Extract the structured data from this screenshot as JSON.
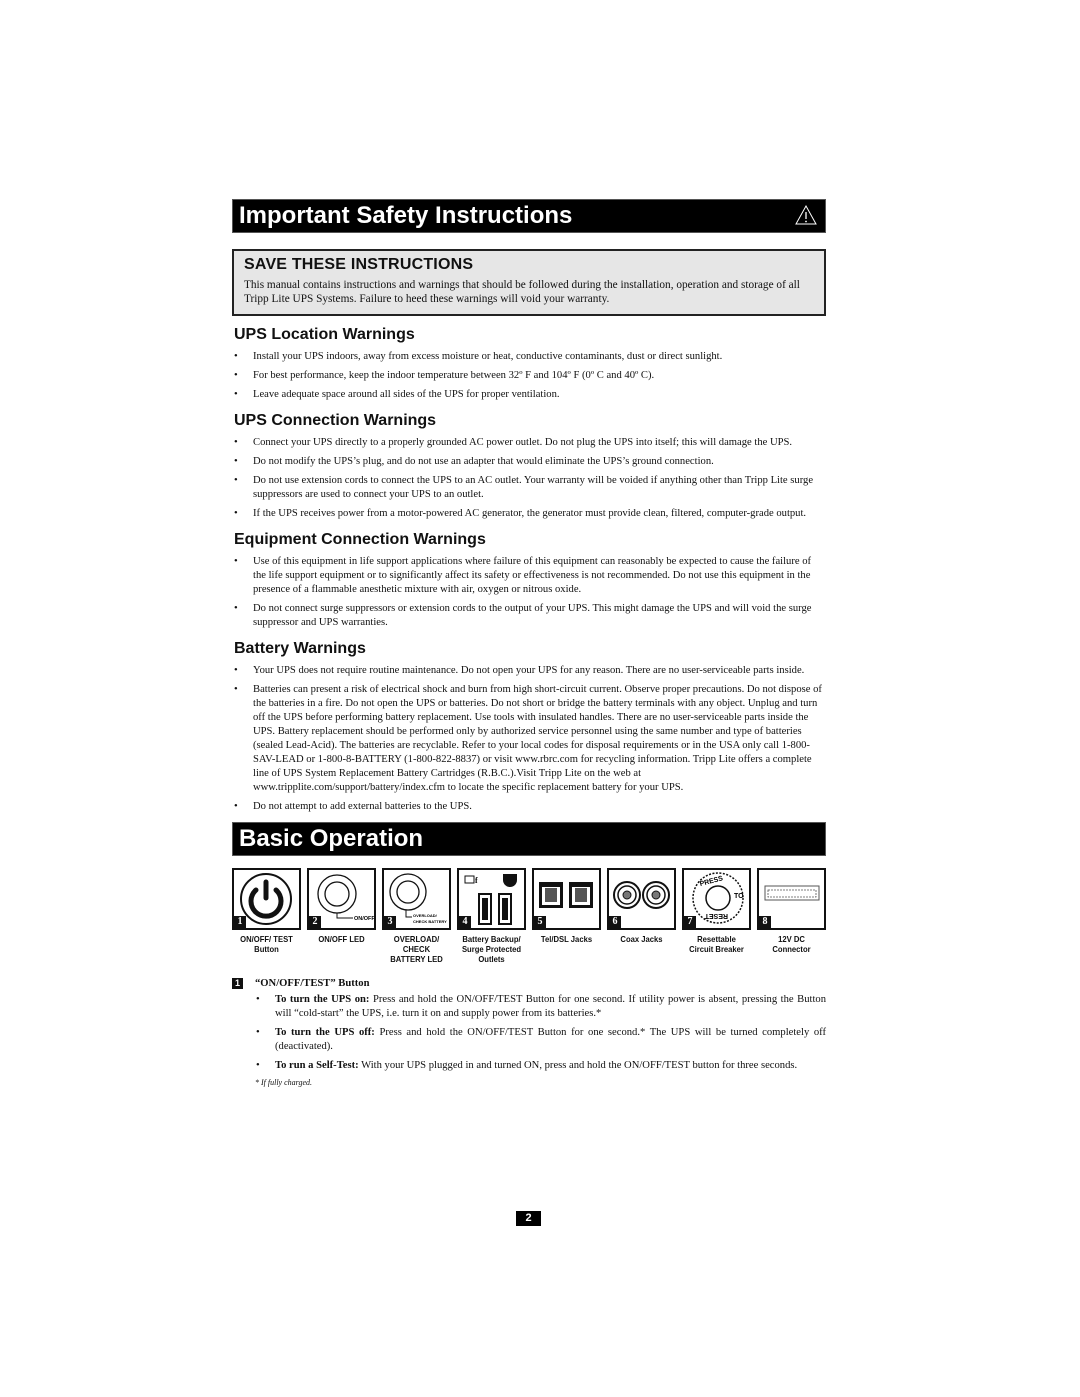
{
  "header": {
    "title": "Important Safety Instructions",
    "icon": "warning-triangle-icon"
  },
  "save_box": {
    "title": "SAVE THESE INSTRUCTIONS",
    "text": "This manual contains instructions and warnings that should be followed during the installation, operation and storage of all Tripp Lite UPS Systems. Failure to heed these warnings will void your warranty."
  },
  "sections": [
    {
      "title": "UPS Location Warnings",
      "items": [
        "Install your UPS indoors, away from excess moisture or heat, conductive contaminants, dust or direct sunlight.",
        "For best performance, keep the indoor temperature between 32º F and 104º F (0º C and 40º C).",
        "Leave adequate space around all sides of the UPS for proper ventilation."
      ]
    },
    {
      "title": "UPS Connection Warnings",
      "items": [
        "Connect your UPS directly to a properly grounded AC power outlet. Do not plug the UPS into itself; this will damage the UPS.",
        "Do not modify the UPS’s plug, and do not use an adapter that would eliminate the UPS’s ground connection.",
        "Do not use extension cords to connect the UPS to an AC outlet. Your warranty will be voided if anything other than Tripp Lite surge suppressors are used to connect your UPS to an outlet.",
        "If the UPS receives power from a motor-powered AC generator, the generator must provide clean, filtered, computer-grade output."
      ]
    },
    {
      "title": "Equipment Connection Warnings",
      "items": [
        "Use of this equipment in life support applications where failure of this equipment can reasonably be expected to cause the failure of the life support equipment or to significantly affect its safety or effectiveness is not recommended. Do not use this equipment in the presence of a flammable anesthetic mixture with air, oxygen or nitrous oxide.",
        "Do not connect surge suppressors or extension cords to the output of your UPS. This might damage the UPS and will void the surge suppressor and UPS warranties."
      ]
    },
    {
      "title": "Battery Warnings",
      "items": [
        "Your UPS does not require routine maintenance. Do not open your UPS for any reason. There are no user-serviceable parts inside.",
        "Batteries can present a risk of electrical shock and burn from high short-circuit current. Observe proper precautions. Do not dispose of the batteries in a fire. Do not open the UPS or batteries. Do not short or bridge the battery terminals with any object. Unplug and turn off the UPS before performing battery replacement. Use tools with insulated handles. There are no user-serviceable parts inside the UPS. Battery replacement should be performed only by authorized service personnel using the same number and type of batteries (sealed Lead-Acid). The batteries are recyclable. Refer to your local codes for disposal requirements or in the USA only call 1-800-SAV-LEAD or 1-800-8-BATTERY (1-800-822-8837) or visit www.rbrc.com for recycling information. Tripp Lite offers a complete line of UPS System Replacement Battery Cartridges (R.B.C.).Visit Tripp Lite on the web at www.tripplite.com/support/battery/index.cfm to locate the specific replacement battery for your UPS.",
        "Do not attempt to add external batteries to the UPS."
      ]
    }
  ],
  "basic_operation": {
    "title": "Basic Operation",
    "panels": [
      {
        "num": "1",
        "icon": "power-button-icon",
        "caption": "ON/OFF/ TEST Button"
      },
      {
        "num": "2",
        "icon": "on-off-led-icon",
        "label": "ON/OFF",
        "caption": "ON/OFF LED"
      },
      {
        "num": "3",
        "icon": "overload-led-icon",
        "label": "OVERLOAD/ CHECK BATTERY",
        "caption": "OVERLOAD/ CHECK BATTERY LED"
      },
      {
        "num": "4",
        "icon": "outlets-icon",
        "caption": "Battery Backup/ Surge Protected Outlets"
      },
      {
        "num": "5",
        "icon": "tel-jack-icon",
        "caption": "Tel/DSL Jacks"
      },
      {
        "num": "6",
        "icon": "coax-jack-icon",
        "caption": "Coax Jacks"
      },
      {
        "num": "7",
        "icon": "circuit-breaker-icon",
        "label": "PRESS TO RESET",
        "caption": "Resettable Circuit Breaker"
      },
      {
        "num": "8",
        "icon": "dc-connector-icon",
        "caption": "12V DC Connector"
      }
    ],
    "button_section": {
      "num": "1",
      "title": "“ON/OFF/TEST” Button",
      "items": [
        {
          "lead": "To turn the UPS on:",
          "text": " Press and hold the ON/OFF/TEST Button for one second. If utility power is absent, pressing the Button will “cold-start” the UPS, i.e. turn it on and supply power from its batteries.*"
        },
        {
          "lead": "To turn the UPS off:",
          "text": " Press and hold the ON/OFF/TEST Button for one second.* The UPS will be turned completely off (deactivated)."
        },
        {
          "lead": "To run a Self-Test:",
          "text": " With your UPS plugged in and turned ON, press and hold the ON/OFF/TEST button for three seconds."
        }
      ],
      "footnote": "* If fully charged."
    }
  },
  "page_number": "2"
}
